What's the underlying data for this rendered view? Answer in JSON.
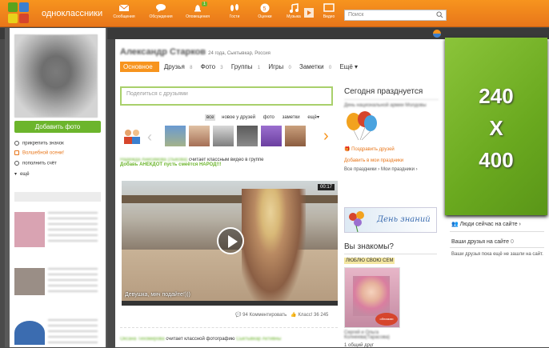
{
  "header": {
    "site_name": "одноклассники",
    "nav": [
      {
        "label": "Сообщения",
        "icon": "envelope-icon"
      },
      {
        "label": "Обсуждения",
        "icon": "discussion-icon"
      },
      {
        "label": "Оповещения",
        "icon": "bell-icon",
        "badge": "1"
      },
      {
        "label": "Гости",
        "icon": "footprints-icon"
      },
      {
        "label": "Оценки",
        "icon": "rating-icon"
      },
      {
        "label": "Музыка",
        "icon": "music-icon"
      },
      {
        "label": "Видео",
        "icon": "video-icon"
      }
    ],
    "search_placeholder": "Поиск"
  },
  "left": {
    "add_photo": "Добавить фото",
    "links": [
      "прикрепить значок",
      "Волшебной осени!",
      "пополнить счёт",
      "ещё"
    ],
    "accent_color": "#e8761a"
  },
  "profile": {
    "name": "Александр Старков",
    "meta": "24 года, Сыктывкар, Россия",
    "tabs": [
      {
        "label": "Основное",
        "count": ""
      },
      {
        "label": "Друзья",
        "count": "8"
      },
      {
        "label": "Фото",
        "count": "3"
      },
      {
        "label": "Группы",
        "count": "1"
      },
      {
        "label": "Игры",
        "count": "0"
      },
      {
        "label": "Заметки",
        "count": "0"
      },
      {
        "label": "Ещё ▾",
        "count": ""
      }
    ]
  },
  "share_placeholder": "Поделиться с друзьями",
  "ribbon_tabs": [
    "все",
    "новое у друзей",
    "фото",
    "заметки",
    "ещё▾"
  ],
  "feed": {
    "item1_user": "Надежда Анисимова (Лыкова)",
    "item1_action": "считает классным видео в группе",
    "item1_group": "Добавь АНЕКДОТ пусть смеётся НАРОД!!!",
    "video_duration": "00:17",
    "video_caption": "Девушка, мяч подайте!)))",
    "comments": "94 Комментировать",
    "likes": "Класс! 36 245",
    "item2_user": "Оксана Тихомирова",
    "item2_action": "считает классной фотографию",
    "item2_target": "Сыктывкар Активны"
  },
  "sidebar_mid": {
    "today": "Сегодня празднуется",
    "today_holiday": "День национальной армии Молдовы",
    "congratulate": "Поздравить друзей",
    "add_holiday": "Добавить в мои праздники",
    "all_holidays": "Все праздники ›",
    "my_holidays": "Мои праздники ›",
    "banner_text": "День знаний",
    "know_title": "Вы знакомы?",
    "love_family": "ЛЮБЛЮ СВОЮ СЕМ",
    "kid_caption": "Сергей и Ольга Колнеева(Тарасова)",
    "mutual": "1 общий друг",
    "stamp": "обнимаю нежно"
  },
  "right": {
    "ad_lines": [
      "240",
      "X",
      "400"
    ],
    "people_now": "Люди сейчас на сайте ›",
    "friends_on_site": "Ваши друзья на сайте",
    "friends_count": "0",
    "friends_none": "Ваши друзья пока ещё не зашли на сайт."
  }
}
